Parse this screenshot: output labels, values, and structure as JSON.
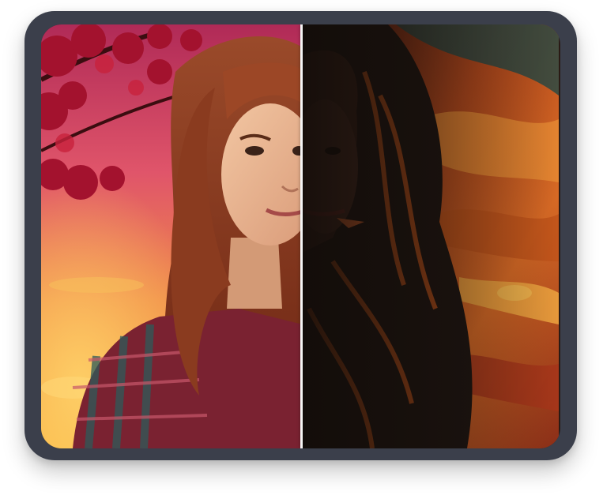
{
  "compare": {
    "left_label": "",
    "right_label": "",
    "split_position": 0.5
  },
  "colors": {
    "frame": "#3b3f4b",
    "divider": "#f4f4f4",
    "sky_top": "#b8305a",
    "sky_bottom": "#f7a23a",
    "leaves": "#a3122e",
    "hair": "#8a3b1f",
    "shirt_red": "#7a2231",
    "shirt_teal": "#2d5b5a",
    "right_dark": "#1c1410",
    "right_orange": "#d65d1a"
  },
  "icons": {
    "divider_handle": "vertical-split-line"
  }
}
